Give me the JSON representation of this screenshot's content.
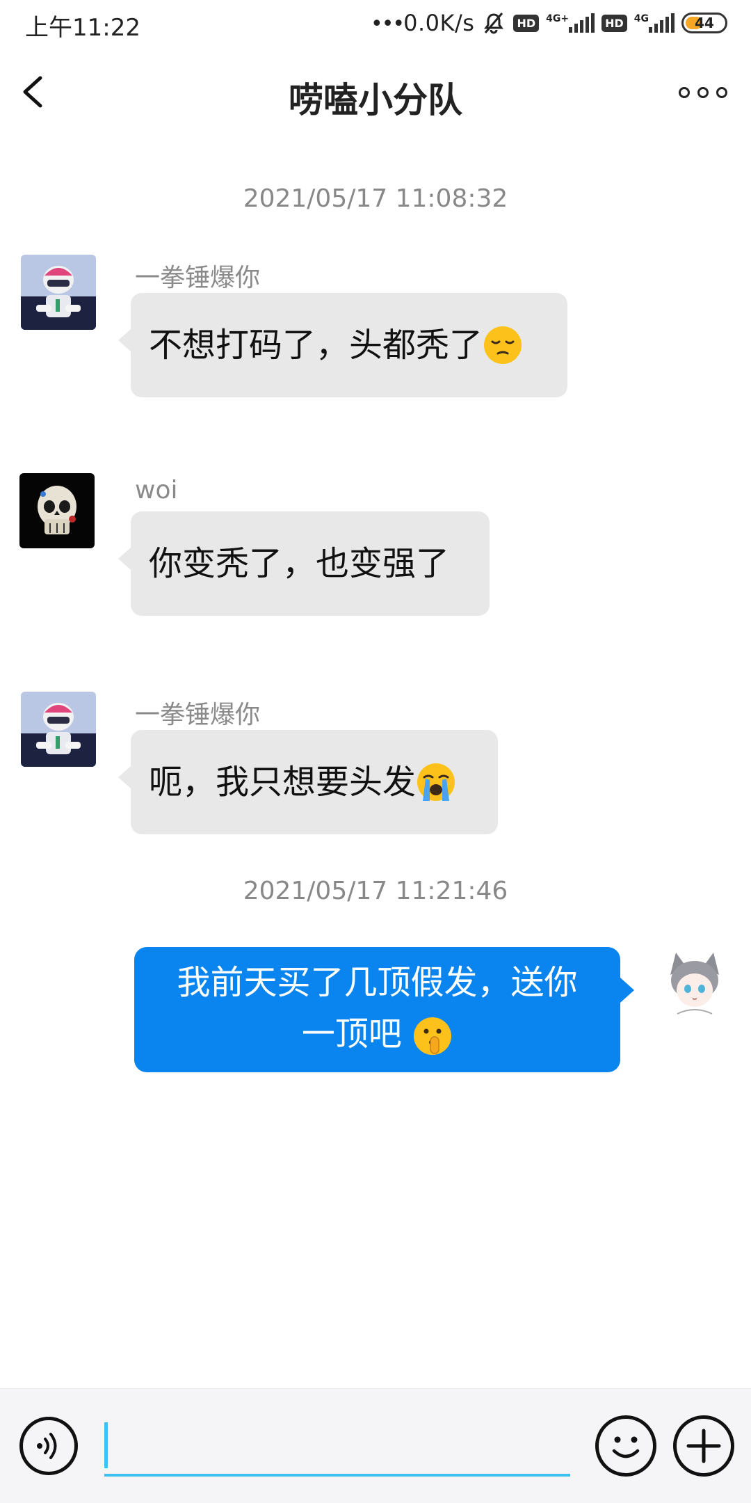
{
  "status_bar": {
    "time": "上午11:22",
    "speed": "0.0K/s",
    "hd_1": "HD",
    "net_1": "4G+",
    "hd_2": "HD",
    "net_2": "4G",
    "battery": "44",
    "battery_level_percent": 44
  },
  "header": {
    "title": "唠嗑小分队",
    "back_icon": "chevron-left-icon",
    "more_icon": "more-horizontal-icon"
  },
  "timestamps": {
    "first": "2021/05/17 11:08:32",
    "second": "2021/05/17 11:21:46"
  },
  "messages": [
    {
      "sender": "一拳锤爆你",
      "text": "不想打码了，头都秃了",
      "emoji": "pensive-face"
    },
    {
      "sender": "woi",
      "text": "你变秃了，也变强了",
      "emoji": ""
    },
    {
      "sender": "一拳锤爆你",
      "text": "呃，我只想要头发",
      "emoji": "loudly-crying-face"
    },
    {
      "sender": "",
      "line1": "我前天买了几顶假发，送你",
      "line2": "一顶吧",
      "emoji": "shushing-face"
    }
  ],
  "input": {
    "placeholder": "",
    "value": ""
  },
  "colors": {
    "outgoing_bubble": "#0a84ef",
    "incoming_bubble": "#e8e8e8",
    "input_underline": "#3ec0f0"
  }
}
